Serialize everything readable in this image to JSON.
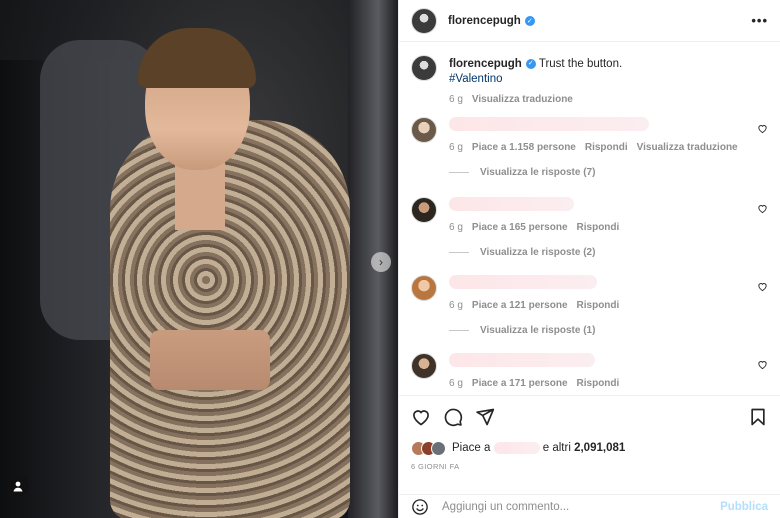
{
  "post": {
    "username": "florencepugh",
    "more_label": "•••"
  },
  "caption": {
    "username": "florencepugh",
    "text": "Trust the button.",
    "hashtag": "#Valentino",
    "time": "6 g",
    "translate": "Visualizza traduzione"
  },
  "comments": [
    {
      "time": "6 g",
      "likes": "Piace a 1.158 persone",
      "reply": "Rispondi",
      "translate": "Visualizza traduzione",
      "replies": "Visualizza le risposte (7)"
    },
    {
      "time": "6 g",
      "likes": "Piace a 165 persone",
      "reply": "Rispondi",
      "replies": "Visualizza le risposte (2)"
    },
    {
      "time": "6 g",
      "likes": "Piace a 121 persone",
      "reply": "Rispondi",
      "replies": "Visualizza le risposte (1)"
    },
    {
      "time": "6 g",
      "likes": "Piace a 171 persone",
      "reply": "Rispondi"
    }
  ],
  "likes": {
    "prefix": "Piace a",
    "suffix": "e altri",
    "count": "2,091,081"
  },
  "date": "6 GIORNI FA",
  "composer": {
    "placeholder": "Aggiungi un commento...",
    "post_label": "Pubblica"
  },
  "carousel": {
    "next": "›"
  }
}
